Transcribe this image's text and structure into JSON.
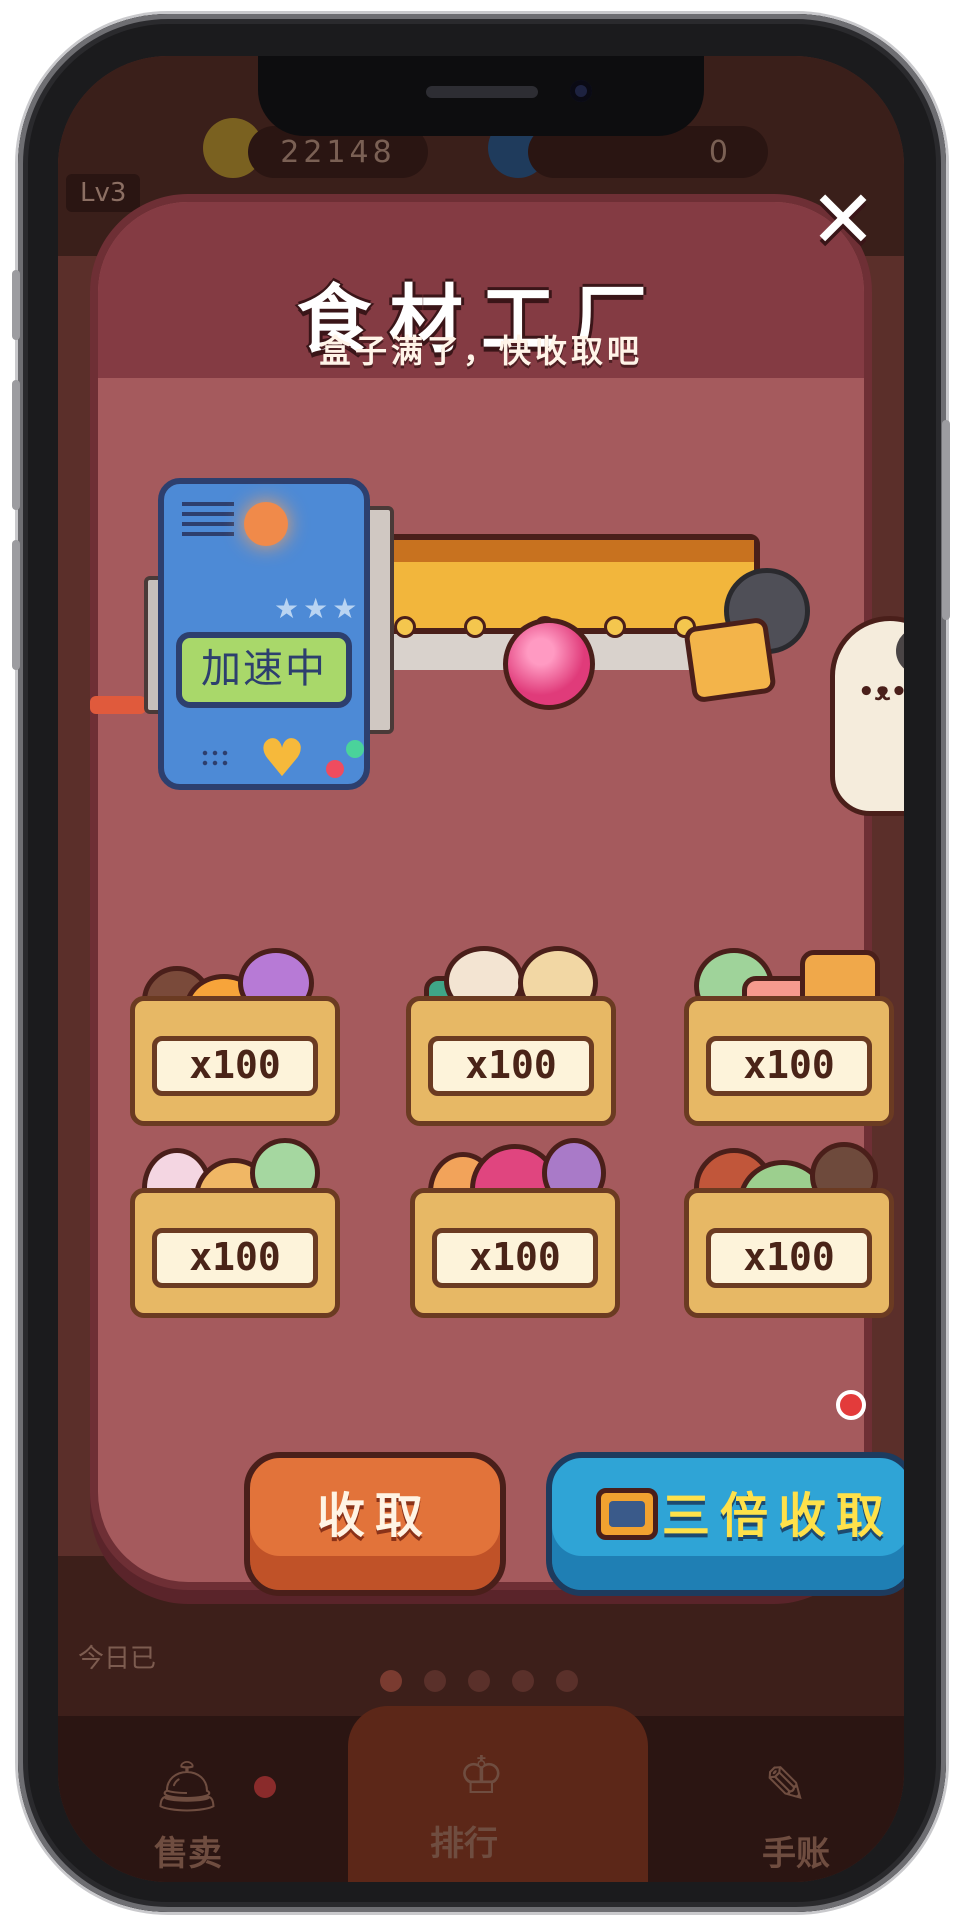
{
  "background": {
    "level": "Lv3",
    "coins": "22148",
    "gems": "0",
    "today_text": "今日已",
    "page_dots": 5,
    "active_dot": 0,
    "nav": [
      {
        "label": "售卖",
        "icon": "bell-icon"
      },
      {
        "label": "排行",
        "icon": "trophy-icon"
      },
      {
        "label": "手账",
        "icon": "notebook-icon"
      }
    ]
  },
  "popup": {
    "title": "食材工厂",
    "close_label": "✕",
    "subtitle": "盒子满了，快收取吧",
    "machine": {
      "screen_text": "加速中",
      "stars": "★★★"
    },
    "boxes": [
      {
        "qty": "x100"
      },
      {
        "qty": "x100"
      },
      {
        "qty": "x100"
      },
      {
        "qty": "x100"
      },
      {
        "qty": "x100"
      },
      {
        "qty": "x100"
      }
    ],
    "collect_label": "收取",
    "triple_collect_label": "三倍收取"
  },
  "colors": {
    "popup_body": "#a55a5d",
    "popup_header": "#843b43",
    "collect_button": "#e2733a",
    "triple_button": "#2fa4d6",
    "triple_text": "#ffe14a"
  }
}
